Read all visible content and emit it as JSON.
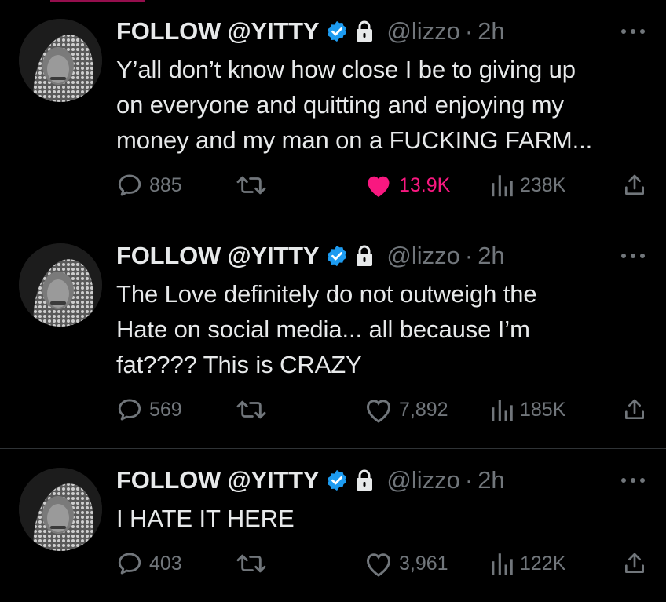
{
  "tweets": [
    {
      "display_name": "FOLLOW @YITTY",
      "handle": "@lizzo",
      "separator": "·",
      "time": "2h",
      "text_lines": [
        "Y’all don’t know how close I be to giving up",
        "on everyone and quitting and enjoying my",
        "money and my man on a FUCKING FARM..."
      ],
      "replies": "885",
      "likes": "13.9K",
      "liked": true,
      "views": "238K"
    },
    {
      "display_name": "FOLLOW @YITTY",
      "handle": "@lizzo",
      "separator": "·",
      "time": "2h",
      "text_lines": [
        "The Love definitely do not outweigh the",
        "Hate on social media... all because I’m",
        "fat???? This is CRAZY"
      ],
      "replies": "569",
      "likes": "7,892",
      "liked": false,
      "views": "185K"
    },
    {
      "display_name": "FOLLOW @YITTY",
      "handle": "@lizzo",
      "separator": "·",
      "time": "2h",
      "text_lines": [
        "I HATE IT HERE"
      ],
      "replies": "403",
      "likes": "3,961",
      "liked": false,
      "views": "122K"
    }
  ],
  "colors": {
    "background": "#000000",
    "text": "#e7e9ea",
    "muted": "#71767b",
    "like_active": "#f91880",
    "verified": "#1d9bf0",
    "divider": "#2f3336"
  },
  "icons": {
    "verified": "verified-badge-icon",
    "protected": "lock-icon",
    "more": "more-dots-icon",
    "reply": "reply-bubble-icon",
    "retweet": "retweet-icon",
    "like": "heart-icon",
    "views": "views-bars-icon",
    "share": "share-icon"
  }
}
